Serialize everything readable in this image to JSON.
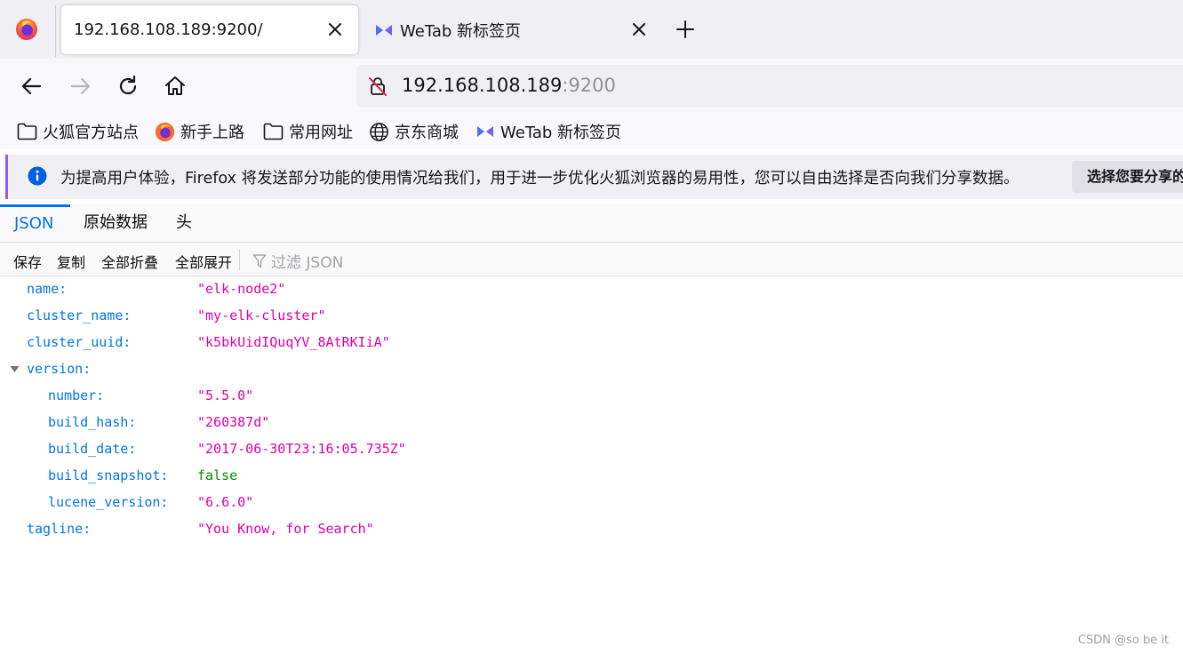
{
  "browser": {
    "tabs": [
      {
        "title": "192.168.108.189:9200/",
        "active": true
      },
      {
        "title": "WeTab 新标签页",
        "active": false
      }
    ],
    "url": {
      "host": "192.168.108.189",
      "port": ":9200"
    },
    "bookmarks": [
      {
        "label": "火狐官方站点",
        "icon": "folder-icon"
      },
      {
        "label": "新手上路",
        "icon": "firefox-icon"
      },
      {
        "label": "常用网址",
        "icon": "folder-icon"
      },
      {
        "label": "京东商城",
        "icon": "globe-icon"
      },
      {
        "label": "WeTab 新标签页",
        "icon": "wetab-icon"
      }
    ],
    "notification": {
      "text": "为提高用户体验，Firefox 将发送部分功能的使用情况给我们，用于进一步优化火狐浏览器的易用性，您可以自由选择是否向我们分享数据。",
      "button": "选择您要分享的"
    }
  },
  "json_viewer": {
    "tabs": [
      "JSON",
      "原始数据",
      "头"
    ],
    "toolbar": [
      "保存",
      "复制",
      "全部折叠",
      "全部展开"
    ],
    "filter_placeholder": "过滤 JSON",
    "rows": [
      {
        "key": "name:",
        "value": "\"elk-node2\""
      },
      {
        "key": "cluster_name:",
        "value": "\"my-elk-cluster\""
      },
      {
        "key": "cluster_uuid:",
        "value": "\"k5bkUidIQuqYV_8AtRKIiA\""
      },
      {
        "key": "version:",
        "value": ""
      },
      {
        "key": "number:",
        "value": "\"5.5.0\""
      },
      {
        "key": "build_hash:",
        "value": "\"260387d\""
      },
      {
        "key": "build_date:",
        "value": "\"2017-06-30T23:16:05.735Z\""
      },
      {
        "key": "build_snapshot:",
        "value": "false"
      },
      {
        "key": "lucene_version:",
        "value": "\"6.6.0\""
      },
      {
        "key": "tagline:",
        "value": "\"You Know, for Search\""
      }
    ]
  },
  "watermark": "CSDN @so be it",
  "colors": {
    "key": "#0074e8",
    "string": "#dd00a9",
    "boolean": "#058b00",
    "accent": "#9059ff"
  }
}
